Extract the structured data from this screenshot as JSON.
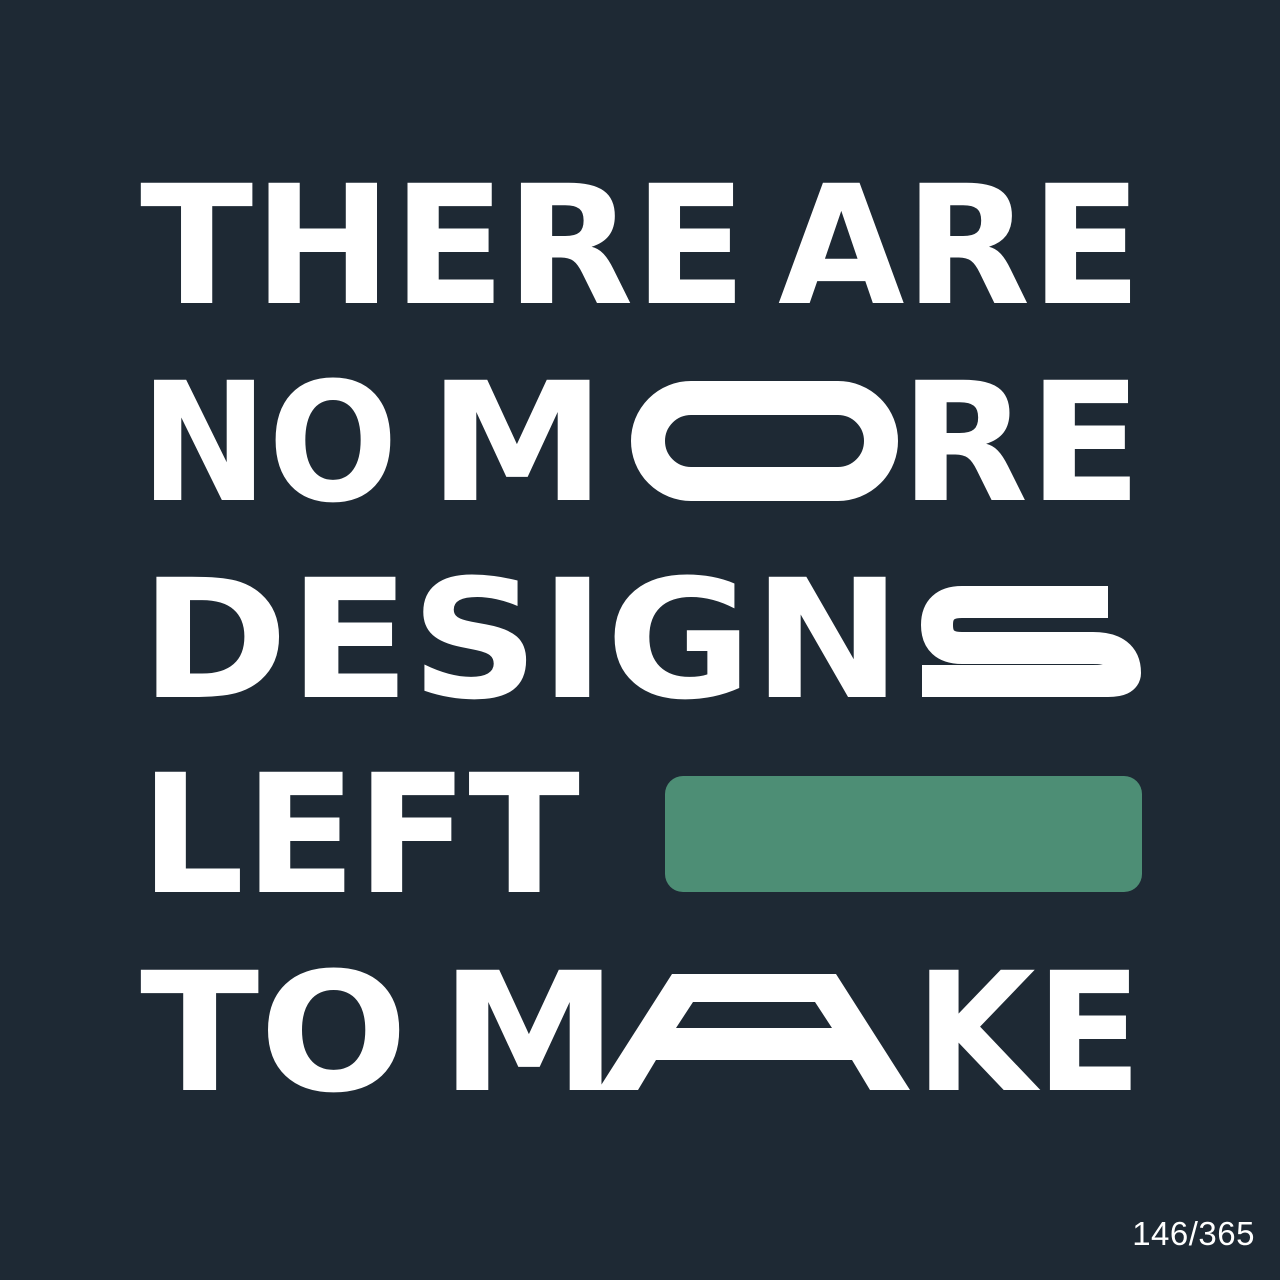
{
  "headline": {
    "line1": {
      "w1": "THERE",
      "w2": "ARE"
    },
    "line2": {
      "w1": "NO",
      "w2a": "M",
      "w2b": "RE"
    },
    "line3": {
      "w1": "DESIGN"
    },
    "line4": {
      "w1": "LEFT"
    },
    "line5": {
      "w1": "TO",
      "w2a": "M",
      "w2b": "KE"
    }
  },
  "stretched_letters": [
    "O",
    "S",
    "A"
  ],
  "counter": "146/365",
  "colors": {
    "background": "#1e2934",
    "text": "#ffffff",
    "accent": "#4d8e75"
  }
}
